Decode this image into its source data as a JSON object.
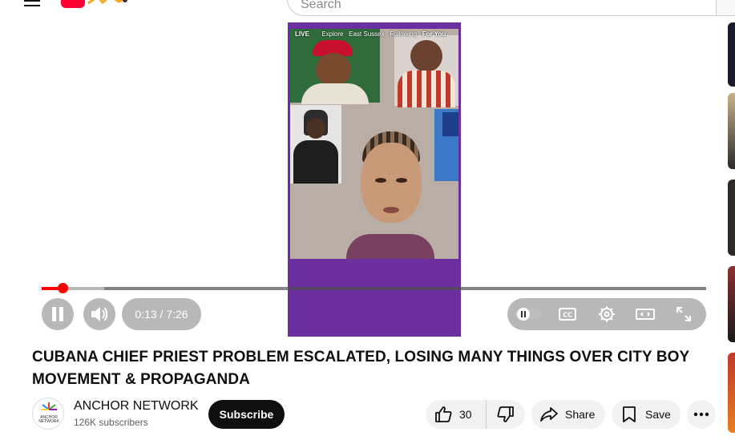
{
  "header": {
    "search_placeholder": "Search"
  },
  "player": {
    "overlay": {
      "live": "LIVE",
      "explore": "Explore",
      "location": "East Sussex",
      "following": "Following",
      "for_you": "For You"
    },
    "time_display": "0:13 / 7:26",
    "progress_fraction": 0.031,
    "buffered_fraction": 0.094,
    "pause_icon": "pause-icon",
    "volume_icon": "volume-icon",
    "autoplay_icon": "autoplay-toggle-icon",
    "captions_icon": "closed-captions-icon",
    "settings_icon": "gear-icon",
    "theater_icon": "theater-mode-icon",
    "fullscreen_icon": "fullscreen-icon"
  },
  "video": {
    "title": "CUBANA CHIEF PRIEST PROBLEM ESCALATED, LOSING MANY THINGS OVER CITY BOY MOVEMENT & PROPAGANDA",
    "channel_name": "ANCHOR NETWORK",
    "channel_avatar_text": "ANCHOR NETWORK",
    "subscribers": "126K subscribers",
    "subscribe_label": "Subscribe",
    "like_count": "30",
    "share_label": "Share",
    "save_label": "Save"
  },
  "colors": {
    "accent": "#ff0000",
    "video_background": "#6b2fa0",
    "text_primary": "#0f0f0f",
    "text_secondary": "#606060"
  }
}
